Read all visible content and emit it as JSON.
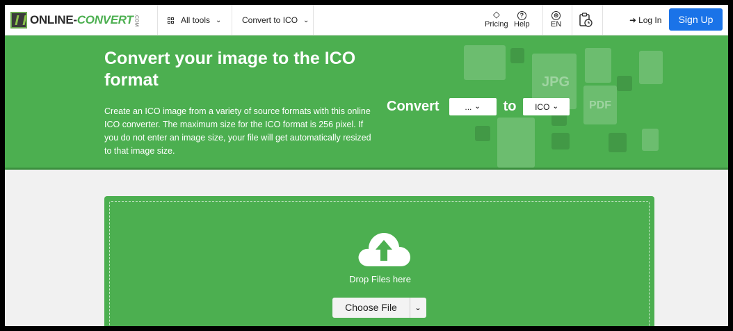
{
  "header": {
    "logo": {
      "text_main": "ONLINE-",
      "text_accent": "CONVERT",
      "text_suffix": ".COM"
    },
    "all_tools_label": "All tools",
    "convert_menu_label": "Convert to ICO",
    "pricing_label": "Pricing",
    "help_label": "Help",
    "language_label": "EN",
    "login_label": "Log In",
    "signup_label": "Sign Up"
  },
  "hero": {
    "title": "Convert your image to the ICO format",
    "description": "Create an ICO image from a variety of source formats with this online ICO converter. The maximum size for the ICO format is 256 pixel. If you do not enter an image size, your file will get automatically resized to that image size.",
    "convert_label": "Convert",
    "source_format": "...",
    "to_label": "to",
    "target_format": "ICO",
    "deco_labels": [
      "JPG",
      "PDF"
    ]
  },
  "upload": {
    "drop_text": "Drop Files here",
    "choose_label": "Choose File"
  },
  "colors": {
    "brand_green": "#4caf50",
    "signup_blue": "#1a73e8"
  }
}
